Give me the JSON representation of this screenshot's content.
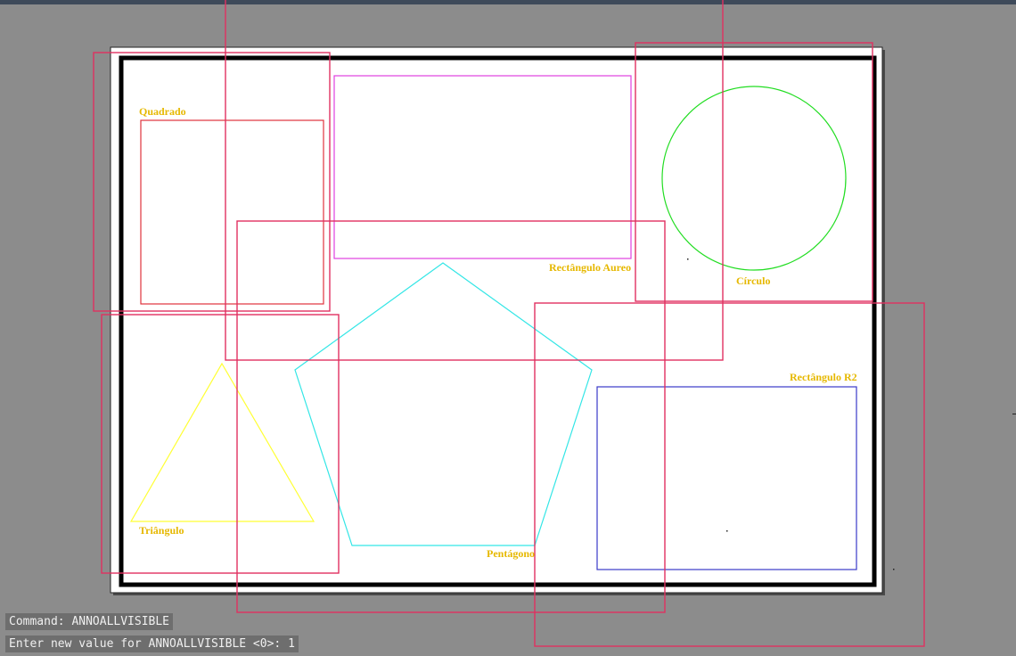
{
  "labels": {
    "quadrado": "Quadrado",
    "retangulo_aureo": "Rectângulo Aureo",
    "circulo": "Círculo",
    "retangulo_r2": "Rectângulo R2",
    "triangulo": "Triângulo",
    "pentagono": "Pentágono"
  },
  "command_line": {
    "history": "Command: ANNOALLVISIBLE",
    "prompt": "Enter new value for ANNOALLVISIBLE <0>: 1"
  },
  "colors": {
    "background": "#8c8c8c",
    "paper": "#ffffff",
    "label_text": "#e6b800",
    "square": "#e0323c",
    "golden_rectangle": "#e040e0",
    "circle": "#22dd22",
    "triangle": "#ffff33",
    "pentagon": "#33e6e6",
    "rectangle_r2": "#3a3ac8",
    "viewport_frame": "#e03060",
    "border": "#000000"
  }
}
